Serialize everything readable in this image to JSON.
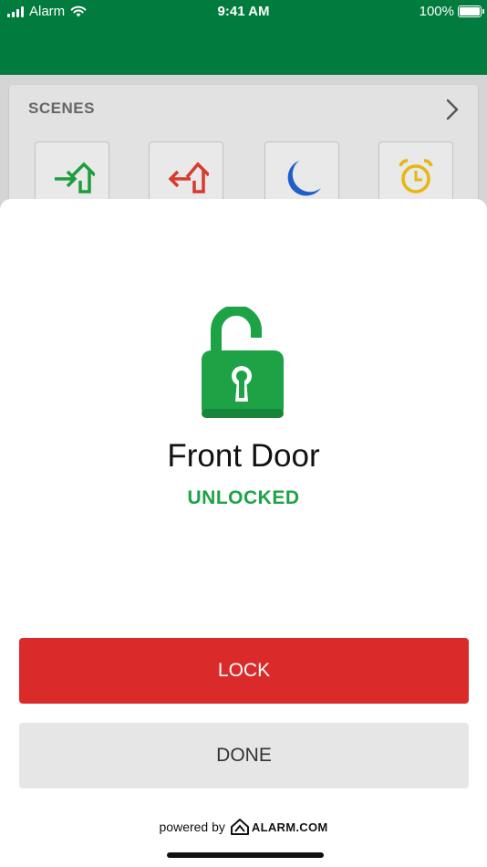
{
  "status_bar": {
    "carrier": "Alarm",
    "time": "9:41 AM",
    "battery": "100%"
  },
  "colors": {
    "header_green": "#027b3e",
    "status_green": "#1da345",
    "lock_red": "#da2a2a",
    "arm_stay_green": "#1e9d3e",
    "arm_away_red": "#d63b2d",
    "night_blue": "#1f5fc7",
    "alarm_yellow": "#e8b60e"
  },
  "scenes": {
    "title": "SCENES",
    "items": [
      {
        "icon": "arrive-home-icon"
      },
      {
        "icon": "leave-home-icon"
      },
      {
        "icon": "moon-icon"
      },
      {
        "icon": "alarm-clock-icon"
      }
    ]
  },
  "device": {
    "icon": "unlocked-padlock-icon",
    "name": "Front Door",
    "status": "UNLOCKED"
  },
  "actions": {
    "lock_label": "LOCK",
    "done_label": "DONE"
  },
  "footer": {
    "powered_by": "powered by",
    "brand": "ALARM.COM"
  }
}
